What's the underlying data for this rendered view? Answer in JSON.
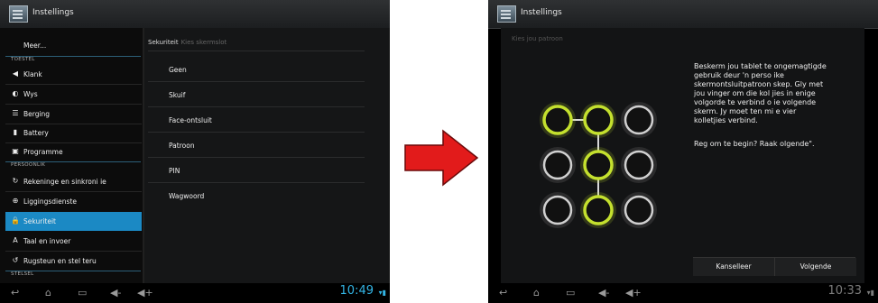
{
  "left_screen": {
    "app_title": "Instellings",
    "list": {
      "top_item": "Meer...",
      "categories": [
        "TOESTEL",
        "PERSOONLIK",
        "STELSEL"
      ],
      "items": [
        {
          "label": "Klank",
          "icon": "speaker-icon"
        },
        {
          "label": "Wys",
          "icon": "brightness-icon"
        },
        {
          "label": "Berging",
          "icon": "storage-icon"
        },
        {
          "label": "Battery",
          "icon": "battery-icon"
        },
        {
          "label": "Programme",
          "icon": "apps-icon"
        },
        {
          "label": "Rekeninge en sinkroni     ie",
          "icon": "sync-icon"
        },
        {
          "label": "Liggingsdienste",
          "icon": "location-icon"
        },
        {
          "label": "Sekuriteit",
          "icon": "lock-icon",
          "selected": true
        },
        {
          "label": "Taal en invoer",
          "icon": "language-icon"
        },
        {
          "label": "Rugsteun en stel teru",
          "icon": "backup-icon"
        }
      ]
    },
    "detail": {
      "title": "Sekuriteit",
      "subtitle": "Kies skermslot",
      "options": [
        "Geen",
        "Skuif",
        "Face-ontsluit",
        "Patroon",
        "PIN",
        "Wagwoord"
      ]
    },
    "clock": "10:49"
  },
  "right_screen": {
    "app_title": "Instellings",
    "header": "Kies jou patroon",
    "instructions": "Beskerm jou tablet te        ongemagtigde\ngebruik deur 'n perso       ike\nskermontsluitpatroon       skep. Gly met\njou vinger om die kol    jies in enige\nvolgorde te verbind o       ie volgende\nskerm. Jy moet ten mi       e vier\nkolletjies verbind.",
    "prompt": "Reg om te begin? Raak        olgende\".",
    "buttons": {
      "cancel": "Kanselleer",
      "next": "Volgende"
    },
    "pattern": {
      "selected_dots": [
        0,
        1,
        4,
        7
      ],
      "dot_color_active": "#c4e02e",
      "dot_color_idle": "#d0d0d0"
    },
    "clock": "10:33"
  },
  "colors": {
    "accent": "#33b5e5",
    "selection": "#1b89c4",
    "arrow": "#e21b1b"
  }
}
